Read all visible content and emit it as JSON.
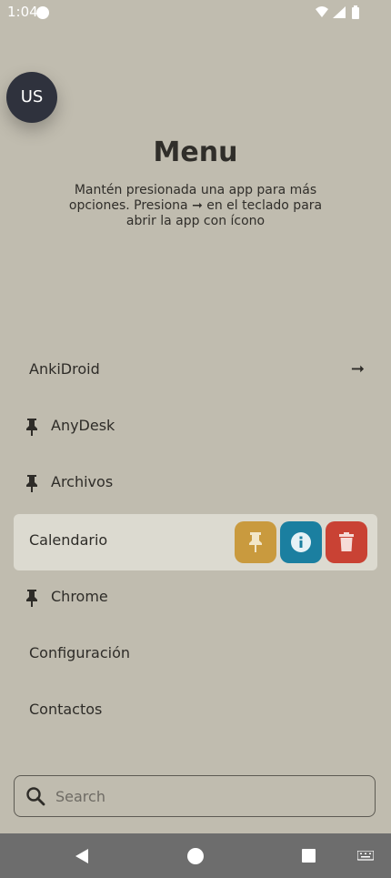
{
  "status_bar": {
    "time": "1:04"
  },
  "avatar": {
    "initials": "US"
  },
  "header": {
    "title": "Menu",
    "subtitle": "Mantén presionada una app para más opciones. Presiona ➞ en el teclado para abrir la app con ícono"
  },
  "apps": [
    {
      "label": "AnkiDroid",
      "pinned": false,
      "trailing_arrow": "➞"
    },
    {
      "label": "AnyDesk",
      "pinned": true
    },
    {
      "label": "Archivos",
      "pinned": true
    },
    {
      "label": "Calendario",
      "pinned": false,
      "selected": true
    },
    {
      "label": "Chrome",
      "pinned": true
    },
    {
      "label": "Configuración",
      "pinned": false
    },
    {
      "label": "Contactos",
      "pinned": false
    }
  ],
  "actions": {
    "pin_color": "#c99a3e",
    "info_color": "#1b7fa0",
    "delete_color": "#c94234"
  },
  "search": {
    "placeholder": "Search"
  },
  "colors": {
    "background": "#c0bcaf",
    "selected_row": "#dcdad0",
    "nav_bar": "#6d6d6d"
  }
}
